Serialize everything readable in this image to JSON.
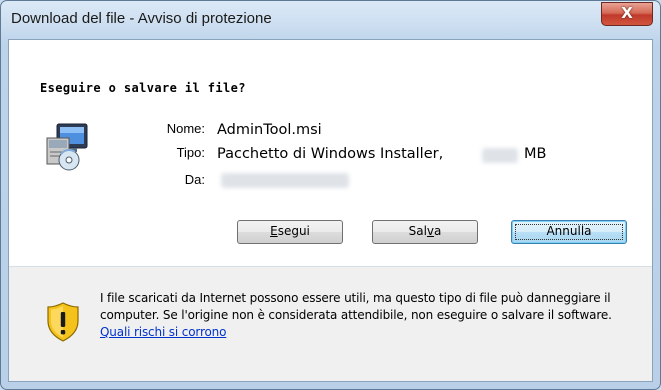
{
  "window": {
    "title": "Download del file - Avviso di protezione",
    "close_glyph": "X"
  },
  "dialog": {
    "heading": "Eseguire o salvare il file?",
    "fields": {
      "name_label": "Nome:",
      "name_value": "AdminTool.msi",
      "type_label": "Tipo:",
      "type_value": "Pacchetto di Windows Installer,",
      "type_unit": "MB",
      "from_label": "Da:"
    },
    "buttons": {
      "run_prefix": "E",
      "run_rest": "segui",
      "save_prefix": "Sal",
      "save_access": "v",
      "save_rest": "a",
      "cancel": "Annulla"
    }
  },
  "footer": {
    "warning_text": "I file scaricati da Internet possono essere utili, ma questo tipo di file può danneggiare il computer. Se l'origine non è considerata attendibile, non eseguire o salvare il software.",
    "link_text": "Quali rischi si corrono"
  },
  "icons": {
    "file": "installer-package-icon",
    "warning": "security-shield-icon"
  },
  "colors": {
    "close_button": "#c0392b",
    "link": "#0033cc",
    "shield_yellow": "#f4c21a"
  }
}
